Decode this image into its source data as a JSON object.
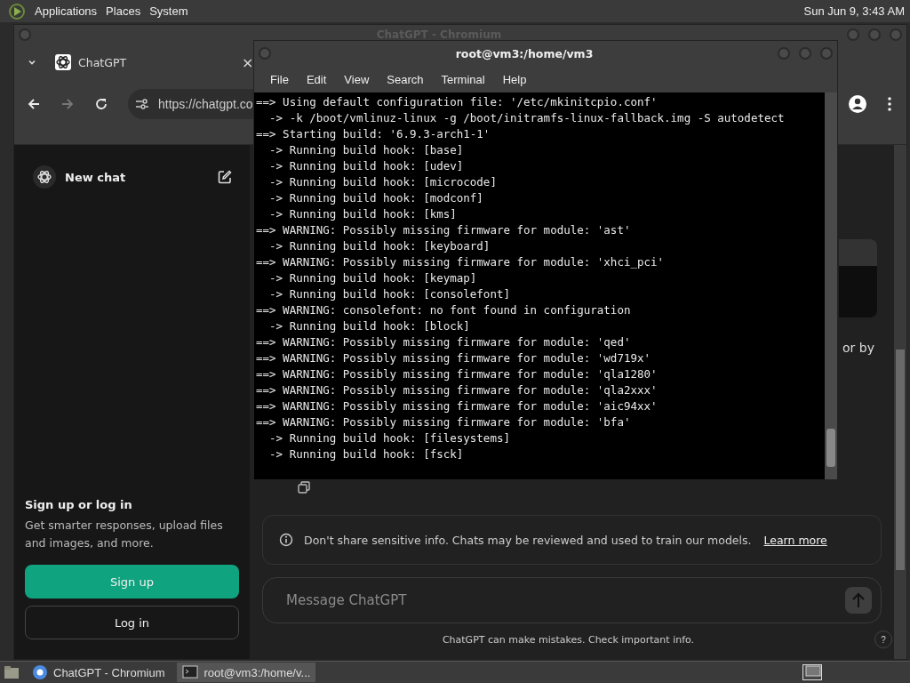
{
  "top_panel": {
    "menus": [
      "Applications",
      "Places",
      "System"
    ],
    "clock": "Sun Jun 9, 3:43 AM"
  },
  "browser": {
    "title": "ChatGPT - Chromium",
    "tab": {
      "label": "ChatGPT",
      "close": "×"
    },
    "url": "https://chatgpt.co",
    "sidebar": {
      "new_chat": "New chat",
      "signup_title": "Sign up or log in",
      "signup_text": "Get smarter responses, upload files and images, and more.",
      "buttons": [
        {
          "label": "Sign up",
          "kind": "primary"
        },
        {
          "label": "Log in",
          "kind": "secondary"
        }
      ]
    },
    "main": {
      "partial_text": "or by",
      "notice": "Don't share sensitive info. Chats may be reviewed and used to train our models.",
      "notice_link": "Learn more",
      "message_placeholder": "Message ChatGPT",
      "footer": "ChatGPT can make mistakes. Check important info.",
      "help": "?"
    }
  },
  "terminal": {
    "title": "root@vm3:/home/vm3",
    "menu": [
      "File",
      "Edit",
      "View",
      "Search",
      "Terminal",
      "Help"
    ],
    "lines": [
      "==> Using default configuration file: '/etc/mkinitcpio.conf'",
      "  -> -k /boot/vmlinuz-linux -g /boot/initramfs-linux-fallback.img -S autodetect",
      "==> Starting build: '6.9.3-arch1-1'",
      "  -> Running build hook: [base]",
      "  -> Running build hook: [udev]",
      "  -> Running build hook: [microcode]",
      "  -> Running build hook: [modconf]",
      "  -> Running build hook: [kms]",
      "==> WARNING: Possibly missing firmware for module: 'ast'",
      "  -> Running build hook: [keyboard]",
      "==> WARNING: Possibly missing firmware for module: 'xhci_pci'",
      "  -> Running build hook: [keymap]",
      "  -> Running build hook: [consolefont]",
      "==> WARNING: consolefont: no font found in configuration",
      "  -> Running build hook: [block]",
      "==> WARNING: Possibly missing firmware for module: 'qed'",
      "==> WARNING: Possibly missing firmware for module: 'wd719x'",
      "==> WARNING: Possibly missing firmware for module: 'qla1280'",
      "==> WARNING: Possibly missing firmware for module: 'qla2xxx'",
      "==> WARNING: Possibly missing firmware for module: 'aic94xx'",
      "==> WARNING: Possibly missing firmware for module: 'bfa'",
      "  -> Running build hook: [filesystems]",
      "  -> Running build hook: [fsck]"
    ]
  },
  "taskbar": [
    {
      "label": "ChatGPT - Chromium",
      "kind": "browser",
      "selected": false
    },
    {
      "label": "root@vm3:/home/v...",
      "kind": "terminal",
      "selected": true
    }
  ]
}
